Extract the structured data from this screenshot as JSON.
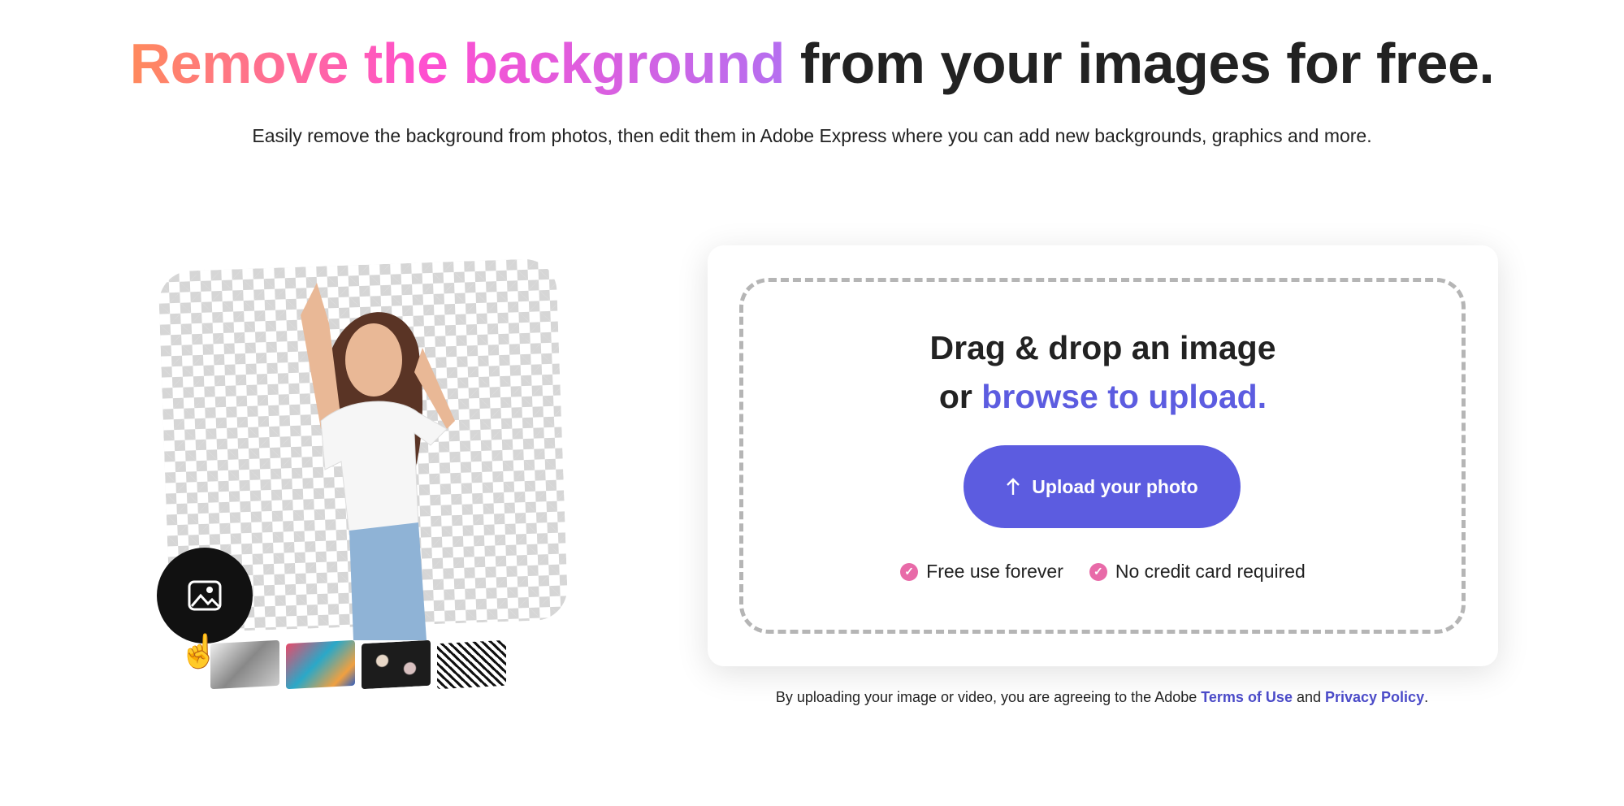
{
  "header": {
    "title_highlight": "Remove the background",
    "title_rest": " from your images for free.",
    "subtitle": "Easily remove the background from photos, then edit them in Adobe Express where you can add new backgrounds, graphics and more.",
    "gradient_colors": [
      "#ff8a5c",
      "#ff4fd0",
      "#b56ff0"
    ]
  },
  "hero": {
    "fab_icon": "image-icon",
    "cursor_icon": "hand-pointer-icon",
    "thumbnails": [
      "gray-leaves",
      "colorful-paint",
      "dark-floral",
      "black-white-pattern"
    ]
  },
  "upload_card": {
    "drop_line1": "Drag & drop an image",
    "drop_or": "or ",
    "drop_link": "browse to upload.",
    "button_label": "Upload your photo",
    "button_icon": "arrow-up-icon",
    "features": [
      "Free use forever",
      "No credit card required"
    ],
    "accent_color": "#5c5ce0",
    "check_color": "#e86aa8"
  },
  "footer": {
    "text": "By uploading your image or video, you are agreeing to the Adobe ",
    "terms": "Terms of Use",
    "and": " and ",
    "privacy": "Privacy Policy",
    "period": "."
  }
}
